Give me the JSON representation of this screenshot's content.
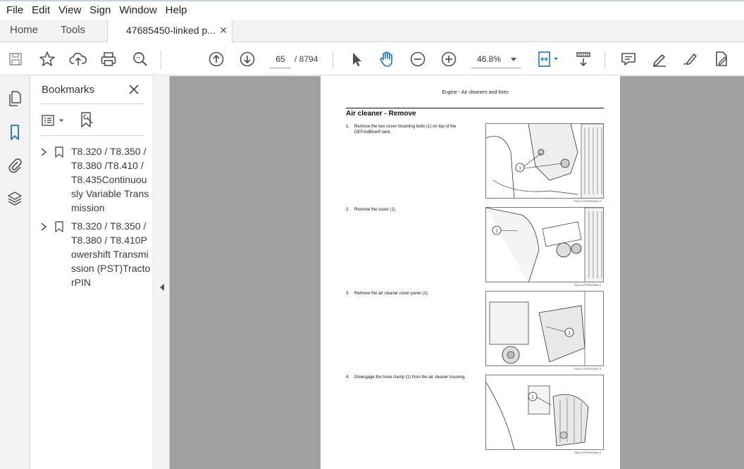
{
  "menu": {
    "file": "File",
    "edit": "Edit",
    "view": "View",
    "sign": "Sign",
    "window": "Window",
    "help": "Help"
  },
  "tabs": {
    "home": "Home",
    "tools": "Tools",
    "doc_title": "47685450-linked p...",
    "close_glyph": "✕"
  },
  "toolbar": {
    "page_current": "65",
    "page_total": "/ 8794",
    "zoom": "46.8%"
  },
  "bookmarks": {
    "title": "Bookmarks",
    "items": [
      {
        "label": "T8.320 / T8.350 / T8.380 /T8.410 / T8.435Continuously Variable Transmission"
      },
      {
        "label": "T8.320 / T8.350 / T8.380 / T8.410Powershift Transmission (PST)TractorPIN"
      }
    ]
  },
  "document": {
    "header": "Engine - Air cleaners and lines",
    "heading": "Air cleaner - Remove",
    "steps": [
      {
        "num": "1.",
        "text": "Remove the two cover mounting bolts (1) on top of the DEF/AdBlue® tank.",
        "caption": "RAIL14TR00000AA   1"
      },
      {
        "num": "2.",
        "text": "Remove the cover (1).",
        "caption": "RAIL14TR00000AA   2"
      },
      {
        "num": "3.",
        "text": "Remove the air cleaner cover panel (1).",
        "caption": "RAIL14TR00000AA   3"
      },
      {
        "num": "4.",
        "text": "Disengage the hose clamp (1) from the air cleaner housing.",
        "caption": "RAIL14TR00000AA   4"
      }
    ]
  },
  "colors": {
    "accent": "#1473e6",
    "doc_background": "#a0a0a0",
    "icon": "#505050"
  }
}
